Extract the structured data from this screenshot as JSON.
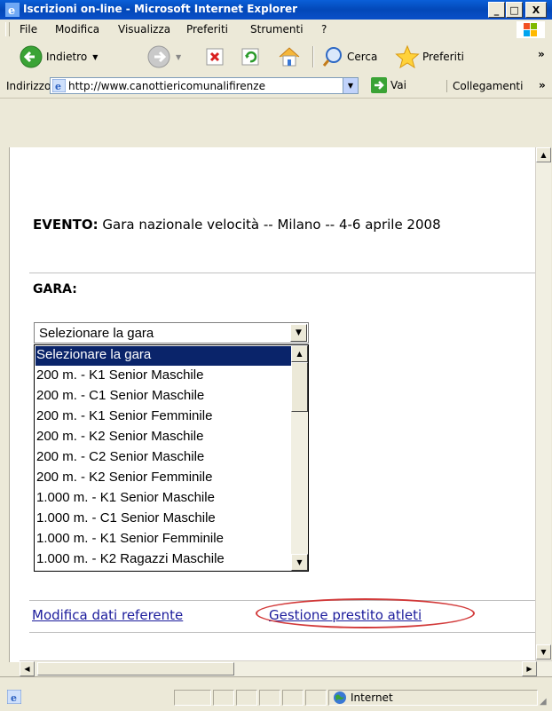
{
  "window": {
    "title": "Iscrizioni on-line - Microsoft Internet Explorer",
    "minimize": "_",
    "maximize": "□",
    "close": "X"
  },
  "menu": {
    "items": [
      "File",
      "Modifica",
      "Visualizza",
      "Preferiti",
      "Strumenti",
      "?"
    ]
  },
  "toolbar": {
    "back_label": "Indietro",
    "search_label": "Cerca",
    "favorites_label": "Preferiti",
    "more": "»"
  },
  "address_bar": {
    "label": "Indirizzo",
    "url": "http://www.canottiericomunalifirenze",
    "go_label": "Vai",
    "links_label": "Collegamenti",
    "links_more": "»"
  },
  "page": {
    "event_label": "EVENTO:",
    "event_value": "Gara nazionale velocità -- Milano -- 4-6 aprile 2008",
    "gara_label": "GARA:",
    "select_value": "Selezionare la gara",
    "options": [
      "Selezionare la gara",
      "200 m. - K1 Senior Maschile",
      "200 m. - C1 Senior Maschile",
      "200 m. - K1 Senior Femminile",
      "200 m. - K2 Senior Maschile",
      "200 m. - C2 Senior Maschile",
      "200 m. - K2 Senior Femminile",
      "1.000 m. - K1 Senior Maschile",
      "1.000 m. - C1 Senior Maschile",
      "1.000 m. - K1 Senior Femminile",
      "1.000 m. - K2 Ragazzi Maschile"
    ],
    "link_modifica": "Modifica dati referente",
    "link_gestione": "Gestione prestito atleti"
  },
  "status": {
    "zone": "Internet"
  },
  "colors": {
    "titlebar": "#0a5fd8",
    "selection": "#0a246a",
    "link": "#1c1c9c",
    "highlight_oval": "#d23a3a"
  }
}
